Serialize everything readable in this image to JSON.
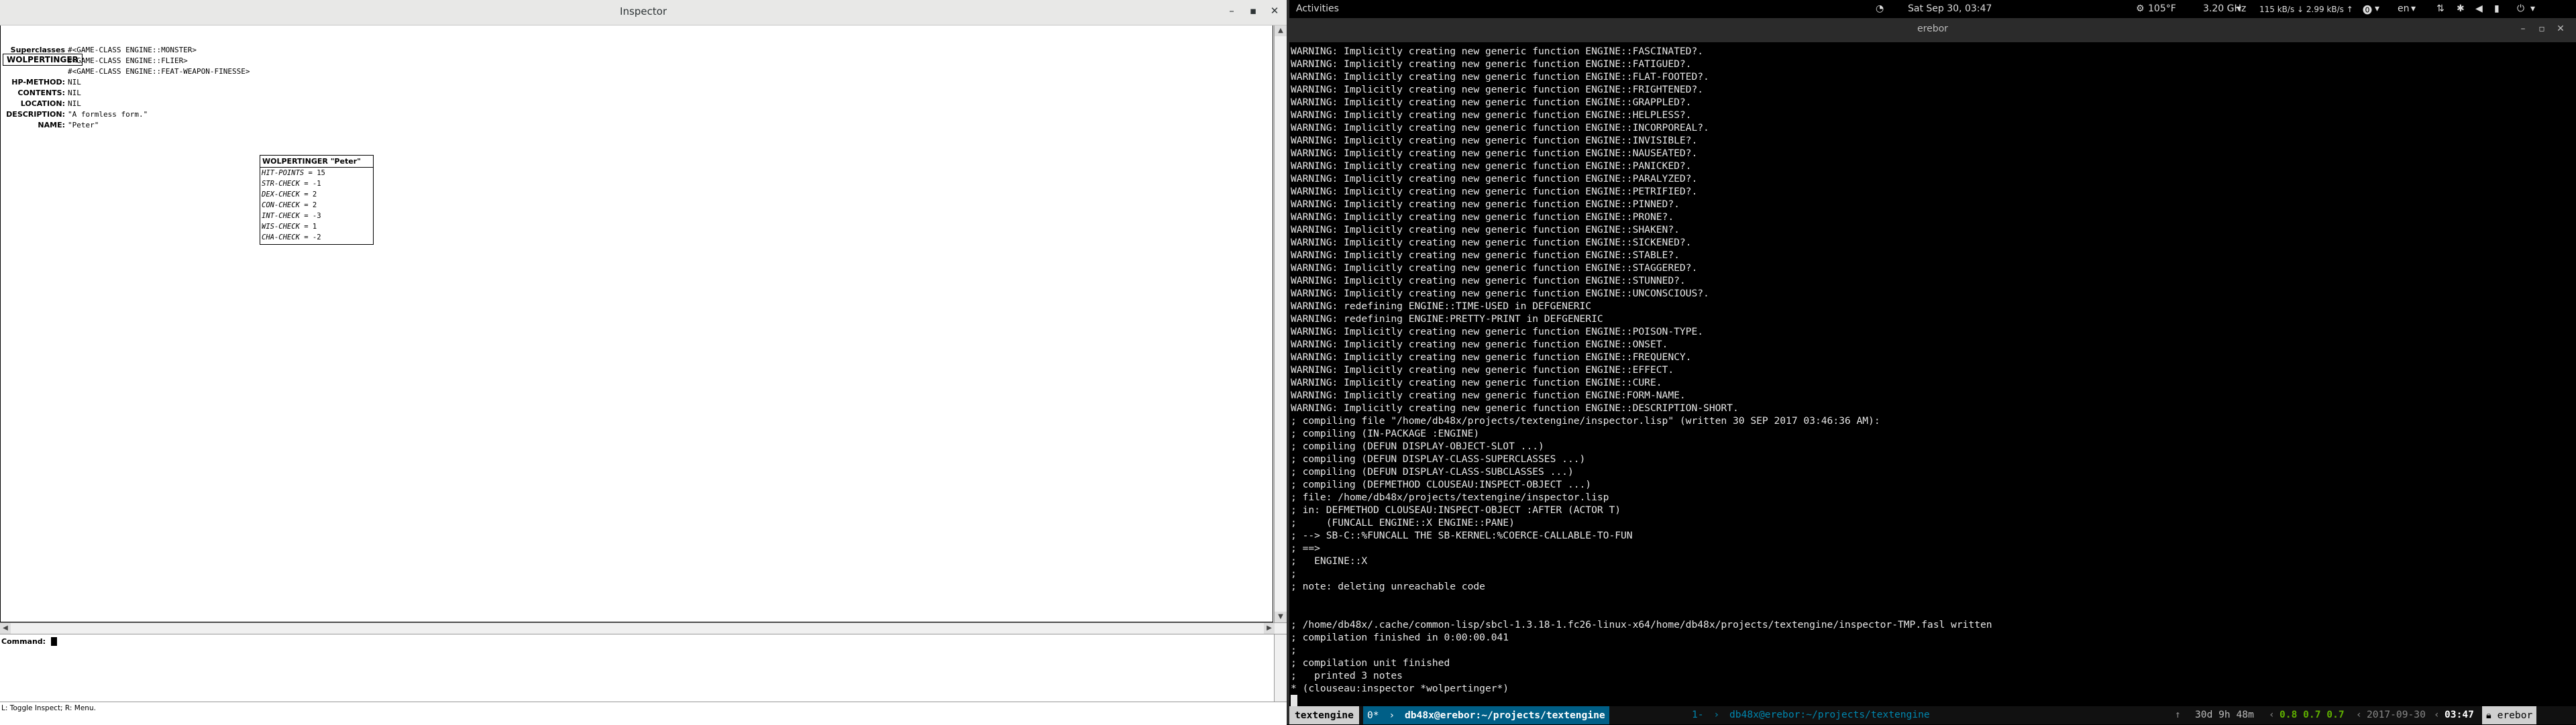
{
  "inspector": {
    "window_title": "Inspector",
    "object_name": "WOLPERTINGER",
    "slots": [
      {
        "key": "Superclasses",
        "values": [
          "#<GAME-CLASS ENGINE::MONSTER>",
          "#<GAME-CLASS ENGINE::FLIER>",
          "#<GAME-CLASS ENGINE::FEAT-WEAPON-FINESSE>"
        ]
      },
      {
        "key": "HP-METHOD:",
        "values": [
          "NIL"
        ]
      },
      {
        "key": "CONTENTS:",
        "values": [
          "NIL"
        ]
      },
      {
        "key": "LOCATION:",
        "values": [
          "NIL"
        ]
      },
      {
        "key": "DESCRIPTION:",
        "values": [
          "\"A formless form.\""
        ]
      },
      {
        "key": "NAME:",
        "values": [
          "\"Peter\""
        ]
      }
    ],
    "popup": {
      "title": "WOLPERTINGER \"Peter\"",
      "rows": [
        {
          "k": "HIT-POINTS",
          "v": "= 15"
        },
        {
          "k": "STR-CHECK",
          "v": "= -1"
        },
        {
          "k": "DEX-CHECK",
          "v": "= 2"
        },
        {
          "k": "CON-CHECK",
          "v": "= 2"
        },
        {
          "k": "INT-CHECK",
          "v": "= -3"
        },
        {
          "k": "WIS-CHECK",
          "v": "= 1"
        },
        {
          "k": "CHA-CHECK",
          "v": "= -2"
        }
      ]
    },
    "command_label": "Command:",
    "command_value": "",
    "status": "L: Toggle Inspect; R: Menu."
  },
  "topbar": {
    "activities": "Activities",
    "datetime": "Sat Sep 30, 03:47",
    "temperature": "105°F",
    "cpu_speed": "3.20 GHz",
    "network": "115 kB/s ↓ 2.99 kB/s ↑",
    "language": "en"
  },
  "terminal": {
    "window_title": "erebor",
    "lines": [
      "WARNING: Implicitly creating new generic function ENGINE::FASCINATED?.",
      "WARNING: Implicitly creating new generic function ENGINE::FATIGUED?.",
      "WARNING: Implicitly creating new generic function ENGINE::FLAT-FOOTED?.",
      "WARNING: Implicitly creating new generic function ENGINE::FRIGHTENED?.",
      "WARNING: Implicitly creating new generic function ENGINE::GRAPPLED?.",
      "WARNING: Implicitly creating new generic function ENGINE::HELPLESS?.",
      "WARNING: Implicitly creating new generic function ENGINE::INCORPOREAL?.",
      "WARNING: Implicitly creating new generic function ENGINE::INVISIBLE?.",
      "WARNING: Implicitly creating new generic function ENGINE::NAUSEATED?.",
      "WARNING: Implicitly creating new generic function ENGINE::PANICKED?.",
      "WARNING: Implicitly creating new generic function ENGINE::PARALYZED?.",
      "WARNING: Implicitly creating new generic function ENGINE::PETRIFIED?.",
      "WARNING: Implicitly creating new generic function ENGINE::PINNED?.",
      "WARNING: Implicitly creating new generic function ENGINE::PRONE?.",
      "WARNING: Implicitly creating new generic function ENGINE::SHAKEN?.",
      "WARNING: Implicitly creating new generic function ENGINE::SICKENED?.",
      "WARNING: Implicitly creating new generic function ENGINE::STABLE?.",
      "WARNING: Implicitly creating new generic function ENGINE::STAGGERED?.",
      "WARNING: Implicitly creating new generic function ENGINE::STUNNED?.",
      "WARNING: Implicitly creating new generic function ENGINE::UNCONSCIOUS?.",
      "WARNING: redefining ENGINE::TIME-USED in DEFGENERIC",
      "WARNING: redefining ENGINE:PRETTY-PRINT in DEFGENERIC",
      "WARNING: Implicitly creating new generic function ENGINE::POISON-TYPE.",
      "WARNING: Implicitly creating new generic function ENGINE::ONSET.",
      "WARNING: Implicitly creating new generic function ENGINE::FREQUENCY.",
      "WARNING: Implicitly creating new generic function ENGINE::EFFECT.",
      "WARNING: Implicitly creating new generic function ENGINE::CURE.",
      "WARNING: Implicitly creating new generic function ENGINE:FORM-NAME.",
      "WARNING: Implicitly creating new generic function ENGINE::DESCRIPTION-SHORT.",
      "; compiling file \"/home/db48x/projects/textengine/inspector.lisp\" (written 30 SEP 2017 03:46:36 AM):",
      "; compiling (IN-PACKAGE :ENGINE)",
      "; compiling (DEFUN DISPLAY-OBJECT-SLOT ...)",
      "; compiling (DEFUN DISPLAY-CLASS-SUPERCLASSES ...)",
      "; compiling (DEFUN DISPLAY-CLASS-SUBCLASSES ...)",
      "; compiling (DEFMETHOD CLOUSEAU:INSPECT-OBJECT ...)",
      "; file: /home/db48x/projects/textengine/inspector.lisp",
      "; in: DEFMETHOD CLOUSEAU:INSPECT-OBJECT :AFTER (ACTOR T)",
      ";     (FUNCALL ENGINE::X ENGINE::PANE)",
      "; --> SB-C::%FUNCALL THE SB-KERNEL:%COERCE-CALLABLE-TO-FUN",
      "; ==>",
      ";   ENGINE::X",
      ";",
      "; note: deleting unreachable code",
      "",
      "",
      "; /home/db48x/.cache/common-lisp/sbcl-1.3.18-1.fc26-linux-x64/home/db48x/projects/textengine/inspector-TMP.fasl written",
      "; compilation finished in 0:00:00.041",
      ";",
      "; compilation unit finished",
      ";   printed 3 notes",
      "* (clouseau:inspector *wolpertinger*)"
    ]
  },
  "tmux": {
    "session": "textengine",
    "win0_index": "0*",
    "win0_title": "db48x@erebor:~/projects/textengine",
    "win1_index": "1-",
    "win1_title": "db48x@erebor:~/projects/textengine",
    "uptime": "30d 9h 48m",
    "load": "0.8 0.7 0.7",
    "date": "2017-09-30",
    "time": "03:47",
    "host": "erebor"
  },
  "colors": {
    "tmux_session_bg": "#d0d0d0",
    "tmux_active_bg": "#0087af",
    "tmux_inactive_fg": "#0087af",
    "load_green": "#5faf00"
  }
}
